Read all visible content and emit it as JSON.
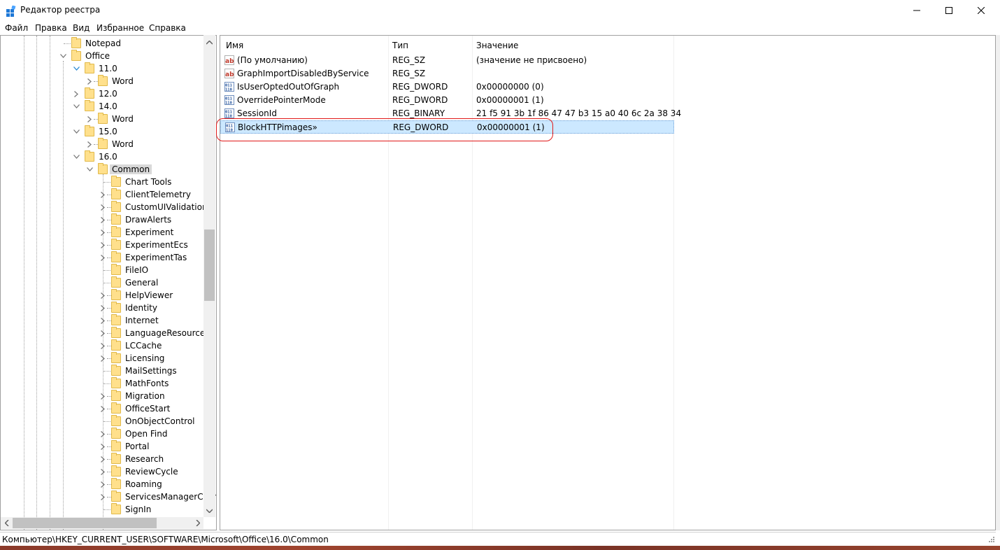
{
  "window": {
    "title": "Редактор реестра",
    "icon": "registry-editor-icon",
    "controls": [
      "minimize-icon",
      "maximize-icon",
      "close-icon"
    ]
  },
  "menu": [
    "Файл",
    "Правка",
    "Вид",
    "Избранное",
    "Справка"
  ],
  "tree": {
    "items": [
      {
        "label": "Notepad",
        "level": 0,
        "expander": "none"
      },
      {
        "label": "Office",
        "level": 0,
        "expander": "expanded"
      },
      {
        "label": "11.0",
        "level": 1,
        "expander": "expanded-hover"
      },
      {
        "label": "Word",
        "level": 2,
        "expander": "collapsed"
      },
      {
        "label": "12.0",
        "level": 1,
        "expander": "collapsed"
      },
      {
        "label": "14.0",
        "level": 1,
        "expander": "expanded"
      },
      {
        "label": "Word",
        "level": 2,
        "expander": "collapsed"
      },
      {
        "label": "15.0",
        "level": 1,
        "expander": "expanded"
      },
      {
        "label": "Word",
        "level": 2,
        "expander": "collapsed"
      },
      {
        "label": "16.0",
        "level": 1,
        "expander": "expanded"
      },
      {
        "label": "Common",
        "level": 2,
        "expander": "expanded",
        "selected": true
      },
      {
        "label": "Chart Tools",
        "level": 3,
        "expander": "none"
      },
      {
        "label": "ClientTelemetry",
        "level": 3,
        "expander": "collapsed"
      },
      {
        "label": "CustomUIValidationC",
        "level": 3,
        "expander": "collapsed"
      },
      {
        "label": "DrawAlerts",
        "level": 3,
        "expander": "collapsed"
      },
      {
        "label": "Experiment",
        "level": 3,
        "expander": "collapsed"
      },
      {
        "label": "ExperimentEcs",
        "level": 3,
        "expander": "collapsed"
      },
      {
        "label": "ExperimentTas",
        "level": 3,
        "expander": "collapsed"
      },
      {
        "label": "FileIO",
        "level": 3,
        "expander": "none"
      },
      {
        "label": "General",
        "level": 3,
        "expander": "none"
      },
      {
        "label": "HelpViewer",
        "level": 3,
        "expander": "collapsed"
      },
      {
        "label": "Identity",
        "level": 3,
        "expander": "collapsed"
      },
      {
        "label": "Internet",
        "level": 3,
        "expander": "collapsed"
      },
      {
        "label": "LanguageResources",
        "level": 3,
        "expander": "collapsed"
      },
      {
        "label": "LCCache",
        "level": 3,
        "expander": "collapsed"
      },
      {
        "label": "Licensing",
        "level": 3,
        "expander": "collapsed"
      },
      {
        "label": "MailSettings",
        "level": 3,
        "expander": "none"
      },
      {
        "label": "MathFonts",
        "level": 3,
        "expander": "none"
      },
      {
        "label": "Migration",
        "level": 3,
        "expander": "collapsed"
      },
      {
        "label": "OfficeStart",
        "level": 3,
        "expander": "collapsed"
      },
      {
        "label": "OnObjectControl",
        "level": 3,
        "expander": "none"
      },
      {
        "label": "Open Find",
        "level": 3,
        "expander": "collapsed"
      },
      {
        "label": "Portal",
        "level": 3,
        "expander": "collapsed"
      },
      {
        "label": "Research",
        "level": 3,
        "expander": "collapsed"
      },
      {
        "label": "ReviewCycle",
        "level": 3,
        "expander": "collapsed"
      },
      {
        "label": "Roaming",
        "level": 3,
        "expander": "collapsed"
      },
      {
        "label": "ServicesManagerCach",
        "level": 3,
        "expander": "collapsed"
      },
      {
        "label": "SignIn",
        "level": 3,
        "expander": "none"
      }
    ]
  },
  "columns": {
    "name": "Имя",
    "type": "Тип",
    "data": "Значение"
  },
  "values": [
    {
      "name": "(По умолчанию)",
      "type": "REG_SZ",
      "data": "(значение не присвоено)",
      "icon": "string-value-icon"
    },
    {
      "name": "GraphImportDisabledByService",
      "type": "REG_SZ",
      "data": "",
      "icon": "string-value-icon"
    },
    {
      "name": "IsUserOptedOutOfGraph",
      "type": "REG_DWORD",
      "data": "0x00000000 (0)",
      "icon": "binary-value-icon"
    },
    {
      "name": "OverridePointerMode",
      "type": "REG_DWORD",
      "data": "0x00000001 (1)",
      "icon": "binary-value-icon"
    },
    {
      "name": "SessionId",
      "type": "REG_BINARY",
      "data": "21 f5 91 3b 1f 86 47 47 b3 15 a0 40 6c 2a 38 34",
      "icon": "binary-value-icon"
    },
    {
      "name": "BlockHTTPimages»",
      "type": "REG_DWORD",
      "data": "0x00000001 (1)",
      "icon": "binary-value-icon",
      "selected": true
    }
  ],
  "status": {
    "path": "Компьютер\\HKEY_CURRENT_USER\\SOFTWARE\\Microsoft\\Office\\16.0\\Common"
  },
  "colors": {
    "selection": "#cce8ff",
    "highlight_circle": "#e11a1a",
    "folder": "#ffe08c"
  }
}
